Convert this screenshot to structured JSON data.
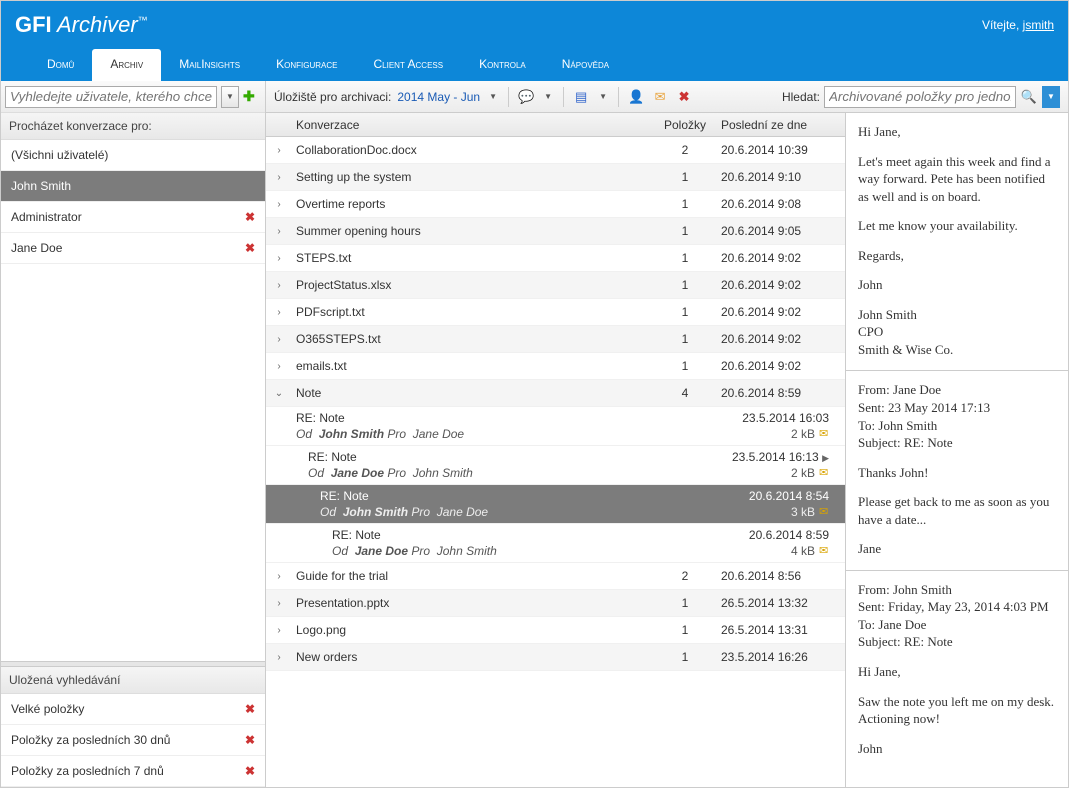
{
  "header": {
    "brand_bold": "GFI",
    "brand_light": "Archiver",
    "welcome_prefix": "Vítejte,",
    "username": "jsmith"
  },
  "nav": [
    "Domů",
    "Archiv",
    "MailInsights",
    "Konfigurace",
    "Client Access",
    "Kontrola",
    "Nápověda"
  ],
  "sidebar": {
    "search_placeholder": "Vyhledejte uživatele, kterého chcete",
    "browse_title": "Procházet konverzace pro:",
    "users": [
      {
        "label": "(Všichni uživatelé)",
        "removable": false,
        "selected": false
      },
      {
        "label": "John Smith",
        "removable": false,
        "selected": true
      },
      {
        "label": "Administrator",
        "removable": true,
        "selected": false
      },
      {
        "label": "Jane Doe",
        "removable": true,
        "selected": false
      }
    ],
    "saved_title": "Uložená vyhledávání",
    "saved": [
      {
        "label": "Velké položky"
      },
      {
        "label": "Položky za posledních 30 dnů"
      },
      {
        "label": "Položky za posledních 7 dnů"
      }
    ]
  },
  "toolbar": {
    "storage_label": "Úložiště pro archivaci:",
    "period": "2014 May - Jun",
    "search_label": "Hledat:",
    "search_placeholder": "Archivované položky pro jednoho už"
  },
  "columns": {
    "c2": "Konverzace",
    "c3": "Položky",
    "c4": "Poslední ze dne"
  },
  "conversations": [
    {
      "expanded": false,
      "name": "CollaborationDoc.docx",
      "count": 2,
      "date": "20.6.2014 10:39"
    },
    {
      "expanded": false,
      "name": "Setting up the system",
      "count": 1,
      "date": "20.6.2014 9:10"
    },
    {
      "expanded": false,
      "name": "Overtime reports",
      "count": 1,
      "date": "20.6.2014 9:08"
    },
    {
      "expanded": false,
      "name": "Summer opening hours",
      "count": 1,
      "date": "20.6.2014 9:05"
    },
    {
      "expanded": false,
      "name": "STEPS.txt",
      "count": 1,
      "date": "20.6.2014 9:02"
    },
    {
      "expanded": false,
      "name": "ProjectStatus.xlsx",
      "count": 1,
      "date": "20.6.2014 9:02"
    },
    {
      "expanded": false,
      "name": "PDFscript.txt",
      "count": 1,
      "date": "20.6.2014 9:02"
    },
    {
      "expanded": false,
      "name": "O365STEPS.txt",
      "count": 1,
      "date": "20.6.2014 9:02"
    },
    {
      "expanded": false,
      "name": "emails.txt",
      "count": 1,
      "date": "20.6.2014 9:02"
    },
    {
      "expanded": true,
      "name": "Note",
      "count": 4,
      "date": "20.6.2014 8:59"
    }
  ],
  "messages": [
    {
      "indent": 30,
      "subject": "RE: Note",
      "date": "23.5.2014 16:03",
      "from_lbl": "Od",
      "from": "John Smith",
      "to_lbl": "Pro",
      "to": "Jane Doe",
      "size": "2 kB",
      "selected": false,
      "arrow": false
    },
    {
      "indent": 42,
      "subject": "RE: Note",
      "date": "23.5.2014 16:13",
      "from_lbl": "Od",
      "from": "Jane Doe",
      "to_lbl": "Pro",
      "to": "John Smith",
      "size": "2 kB",
      "selected": false,
      "arrow": true
    },
    {
      "indent": 54,
      "subject": "RE: Note",
      "date": "20.6.2014 8:54",
      "from_lbl": "Od",
      "from": "John Smith",
      "to_lbl": "Pro",
      "to": "Jane Doe",
      "size": "3 kB",
      "selected": true,
      "arrow": false
    },
    {
      "indent": 66,
      "subject": "RE: Note",
      "date": "20.6.2014 8:59",
      "from_lbl": "Od",
      "from": "Jane Doe",
      "to_lbl": "Pro",
      "to": "John Smith",
      "size": "4 kB",
      "selected": false,
      "arrow": false
    }
  ],
  "conversations2": [
    {
      "name": "Guide for the trial",
      "count": 2,
      "date": "20.6.2014 8:56"
    },
    {
      "name": "Presentation.pptx",
      "count": 1,
      "date": "26.5.2014 13:32"
    },
    {
      "name": "Logo.png",
      "count": 1,
      "date": "26.5.2014 13:31"
    },
    {
      "name": "New orders",
      "count": 1,
      "date": "23.5.2014 16:26"
    }
  ],
  "preview": {
    "p1": "Hi Jane,",
    "p2": "Let's meet again this week and find a way forward. Pete has been notified as well and is on board.",
    "p3": "Let me know your availability.",
    "p4": "Regards,",
    "p5": "John",
    "sig1": "John Smith",
    "sig2": "CPO",
    "sig3": "Smith & Wise Co.",
    "h1a": "From: Jane Doe",
    "h1b": "Sent: 23 May 2014 17:13",
    "h1c": "To: John Smith",
    "h1d": "Subject: RE: Note",
    "r1a": "Thanks John!",
    "r1b": "Please get back to me as soon as you have a date...",
    "r1c": "Jane",
    "h2a": "From: John Smith",
    "h2b": "Sent: Friday, May 23, 2014 4:03 PM",
    "h2c": "To: Jane Doe",
    "h2d": "Subject: RE: Note",
    "r2a": "Hi Jane,",
    "r2b": "Saw the note you left me on my desk. Actioning now!",
    "r2c": "John"
  }
}
